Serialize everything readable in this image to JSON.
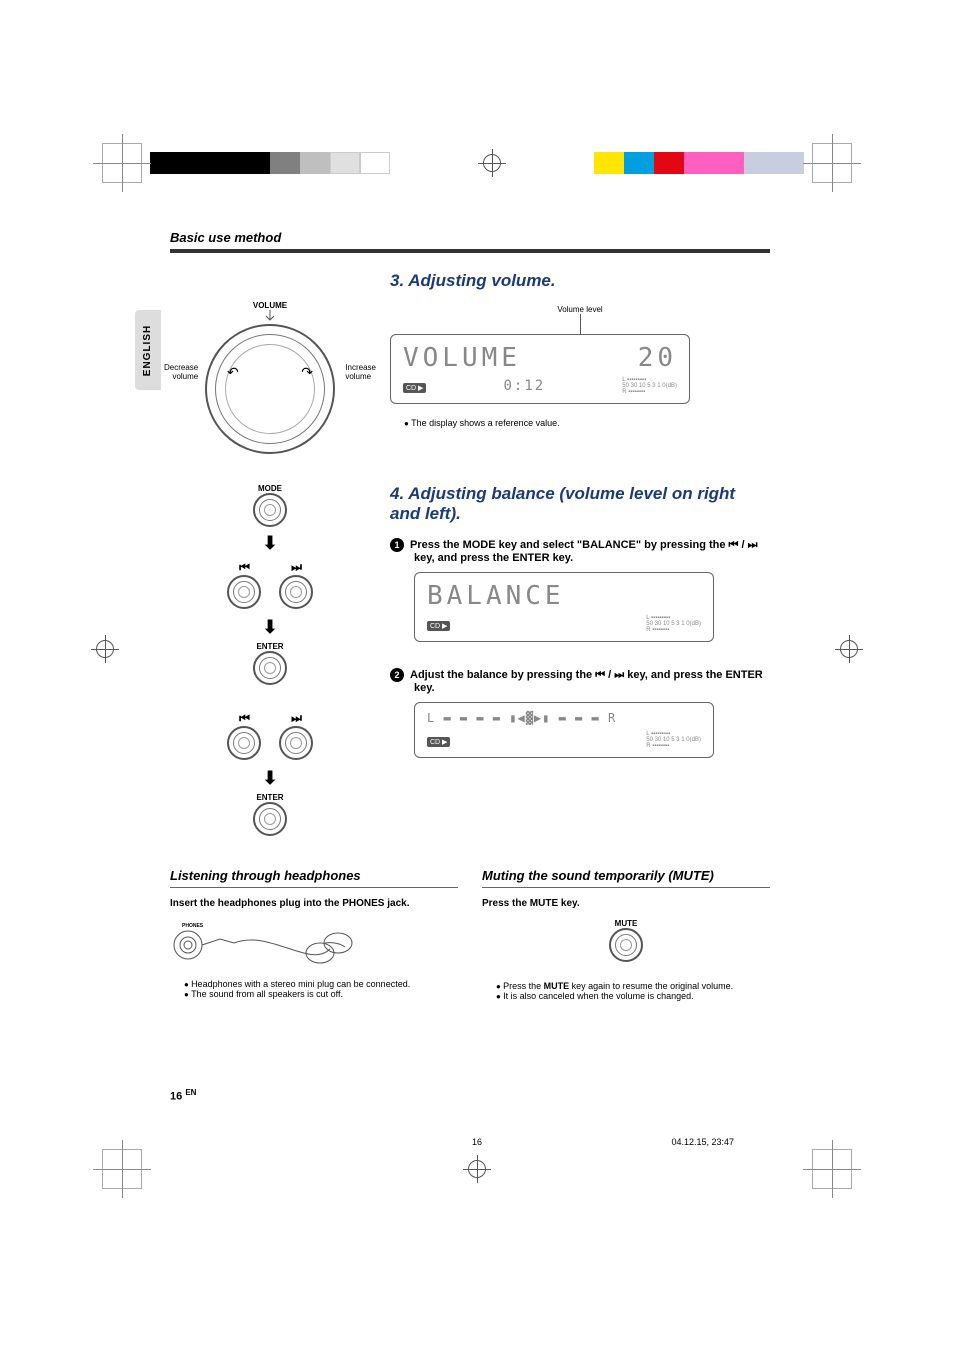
{
  "section_title": "Basic use method",
  "english_tab": "ENGLISH",
  "volume_block": {
    "heading": "3.  Adjusting volume.",
    "dial_caption_top": "VOLUME",
    "dial_left_top": "Decrease",
    "dial_left_bottom": "volume",
    "dial_right_top": "Increase",
    "dial_right_bottom": "volume",
    "callout": "Volume level",
    "display_main": "VOLUME",
    "display_value": "20",
    "display_time": "0:12",
    "cd_label": "CD ▶",
    "note": "The display shows a reference value."
  },
  "balance_block": {
    "heading": "4.  Adjusting balance (volume level on right and left).",
    "mode_label": "MODE",
    "enter_label": "ENTER",
    "step1": "Press the MODE key and select \"BALANCE\" by pressing the ⏮ / ⏭ key, and press the ENTER key.",
    "display_main": "BALANCE",
    "cd_label": "CD ▶",
    "step2": "Adjust the balance by pressing the ⏮ / ⏭ key, and press the ENTER key.",
    "lr_left": "L",
    "lr_right": "R",
    "skip_prev": "⏮",
    "skip_next": "⏭",
    "enter2_label": "ENTER"
  },
  "headphones": {
    "heading": "Listening through headphones",
    "instruction": "Insert the headphones plug into the PHONES jack.",
    "phones_label": "PHONES",
    "note1": "Headphones with a stereo mini plug can be connected.",
    "note2": "The sound from all speakers is cut off."
  },
  "mute": {
    "heading": "Muting the sound temporarily (MUTE)",
    "instruction": "Press the MUTE key.",
    "btn_label": "MUTE",
    "note1_pre": "Press the ",
    "note1_bold": "MUTE",
    "note1_post": " key again to resume the original volume.",
    "note2": "It is also canceled when the volume is changed."
  },
  "footer": {
    "page_big": "16",
    "page_lang": "EN",
    "page_small": "16",
    "timestamp": "04.12.15, 23:47"
  },
  "colors": {
    "top_left": [
      "#000000",
      "#000000",
      "#000000",
      "#000000",
      "#808080",
      "#bfbfbf",
      "#e0e0e0",
      "#ffffff"
    ],
    "top_right": [
      "#ffe600",
      "#00a0e0",
      "#e30613",
      "#ff60c0",
      "#ff60c0",
      "#c8cde0",
      "#c8cde0"
    ],
    "meter_scale": "50 30 10  5  3  1  0(dB)"
  }
}
